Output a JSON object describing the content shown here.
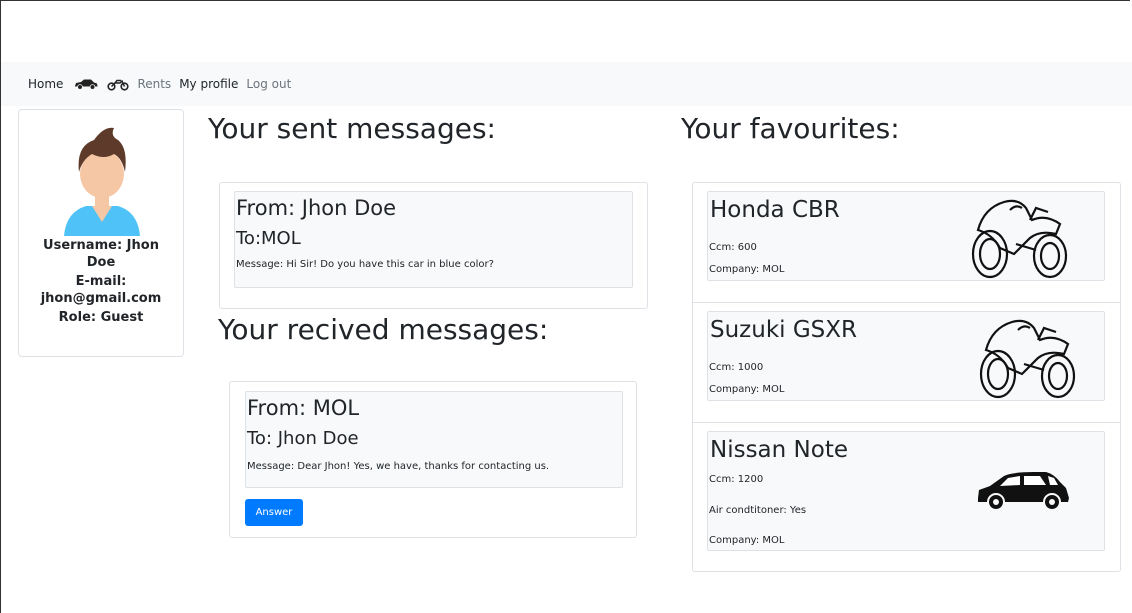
{
  "nav": {
    "home": "Home",
    "car_icon": "car-icon",
    "moto_icon": "motorcycle-icon",
    "rents": "Rents",
    "my_profile": "My profile",
    "logout": "Log out"
  },
  "profile": {
    "avatar_icon": "user-avatar-icon",
    "username": "Username: Jhon Doe",
    "email": "E-mail: jhon@gmail.com",
    "role": "Role: Guest"
  },
  "sent": {
    "title": "Your sent messages:",
    "messages": [
      {
        "from": "From: Jhon Doe",
        "to": "To:MOL",
        "message": "Message: Hi Sir! Do you have this car in blue color?"
      }
    ]
  },
  "received": {
    "title": "Your recived messages:",
    "messages": [
      {
        "from": "From: MOL",
        "to": "To: Jhon Doe",
        "message": "Message: Dear Jhon! Yes, we have, thanks for contacting us.",
        "answer_label": "Answer"
      }
    ]
  },
  "favourites": {
    "title": "Your favourites:",
    "items": [
      {
        "name": "Honda CBR",
        "ccm": "Ccm: 600",
        "company": "Company: MOL",
        "icon": "motorcycle-icon"
      },
      {
        "name": "Suzuki GSXR",
        "ccm": "Ccm: 1000",
        "company": "Company: MOL",
        "icon": "motorcycle-icon"
      },
      {
        "name": "Nissan Note",
        "ccm": "Ccm: 1200",
        "air": "Air condtitoner: Yes",
        "company": "Company: MOL",
        "icon": "car-icon"
      }
    ]
  },
  "colors": {
    "primary": "#007bff",
    "navbar_bg": "#f8f9fa",
    "muted": "#6c757d",
    "avatar_shirt": "#4fc3f7",
    "avatar_hair": "#5d3a2a",
    "avatar_skin": "#f6c7a4"
  }
}
